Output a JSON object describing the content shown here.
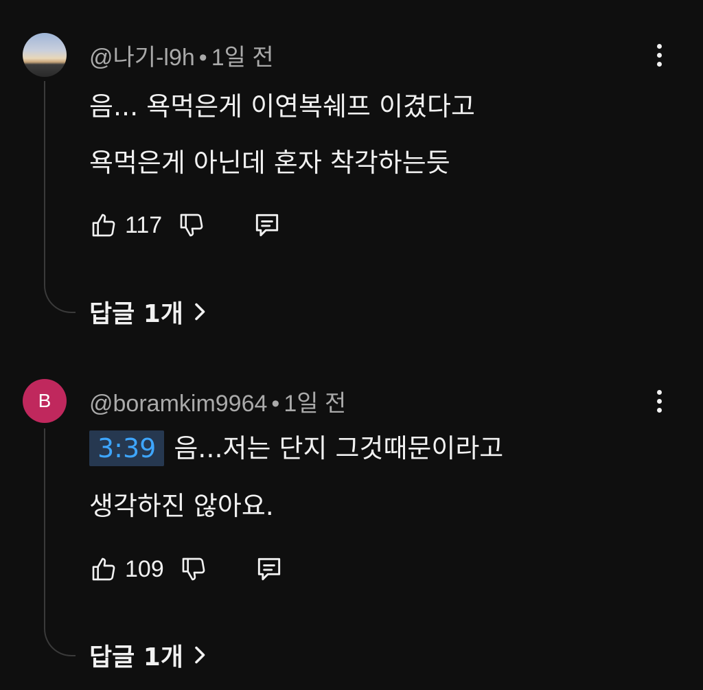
{
  "comments": [
    {
      "handle": "@나기-l9h",
      "separator": "•",
      "time": "1일 전",
      "avatar_type": "photo",
      "lines": [
        "음... 욕먹은게 이연복쉐프 이겼다고",
        "욕먹은게 아닌데 혼자 착각하는듯"
      ],
      "likes": "117",
      "replies_label": "답글 1개"
    },
    {
      "handle": "@boramkim9964",
      "separator": "•",
      "time": "1일 전",
      "avatar_type": "letter",
      "avatar_letter": "B",
      "avatar_color": "#c0285d",
      "timestamp_link": "3:39",
      "lines": [
        "음...저는 단지 그것때문이라고",
        "생각하진 않아요."
      ],
      "likes": "109",
      "replies_label": "답글 1개"
    }
  ],
  "icons": {
    "like": "thumbs-up-icon",
    "dislike": "thumbs-down-icon",
    "reply": "comment-icon",
    "more": "more-vert-icon",
    "expand": "chevron-right-icon"
  },
  "colors": {
    "background": "#0f0f0f",
    "text": "#f1f1f1",
    "meta_text": "#aaaaaa",
    "timestamp_link": "#3ea6ff",
    "timestamp_bg": "#263850"
  }
}
